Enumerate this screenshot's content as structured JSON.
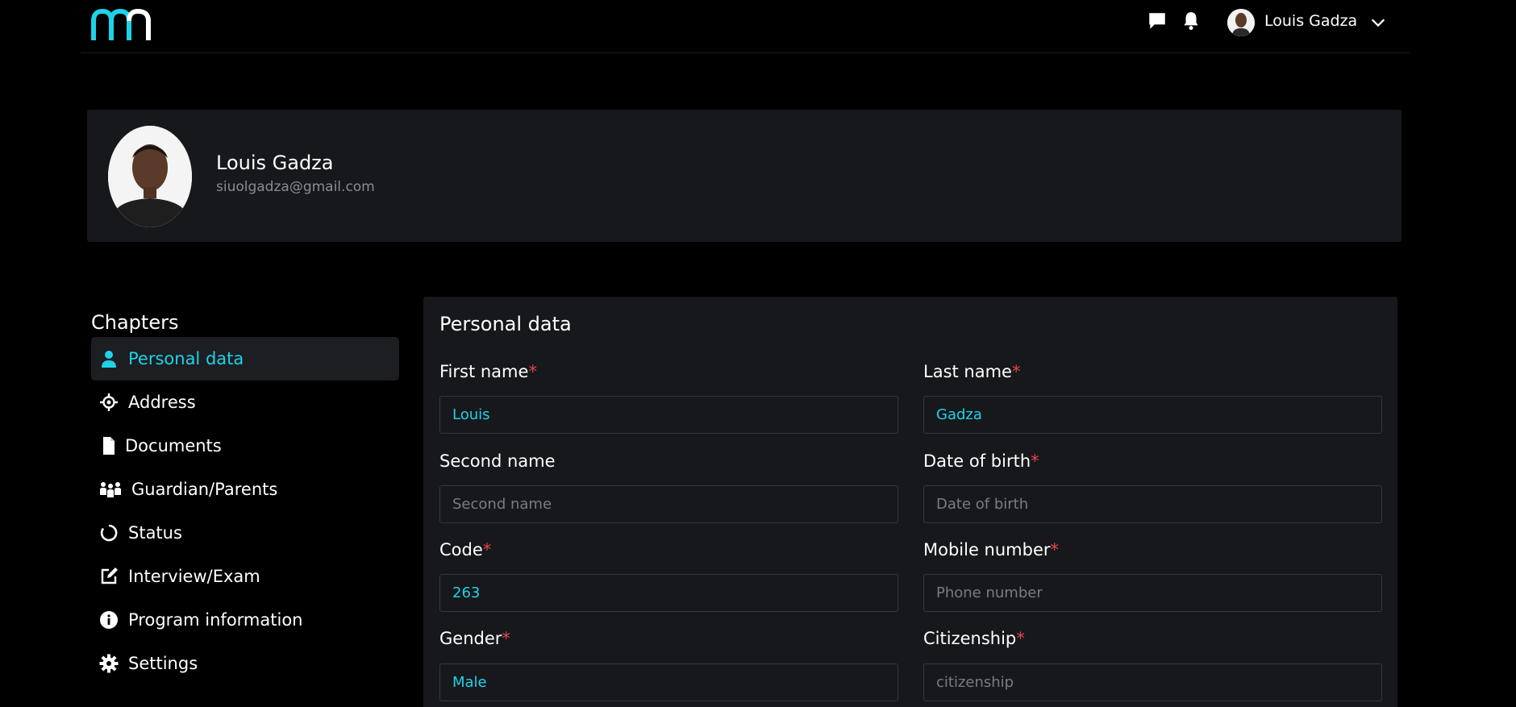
{
  "header": {
    "user_name": "Louis Gadza",
    "icons": [
      "logo-mn",
      "chat-icon",
      "bell-icon",
      "user-avatar",
      "chevron-down-icon"
    ],
    "logo_colors": {
      "m": "#1fd2e8",
      "n": "#ffffff"
    }
  },
  "profile": {
    "name": "Louis Gadza",
    "email": "siuolgadza@gmail.com"
  },
  "sidebar": {
    "title": "Chapters",
    "items": [
      {
        "label": "Personal data",
        "icon": "person-icon",
        "active": true
      },
      {
        "label": "Address",
        "icon": "location-icon"
      },
      {
        "label": "Documents",
        "icon": "document-icon"
      },
      {
        "label": "Guardian/Parents",
        "icon": "family-icon"
      },
      {
        "label": "Status",
        "icon": "status-circle-icon"
      },
      {
        "label": "Interview/Exam",
        "icon": "edit-icon"
      },
      {
        "label": "Program information",
        "icon": "info-icon"
      },
      {
        "label": "Settings",
        "icon": "gear-icon"
      }
    ]
  },
  "form": {
    "title": "Personal data",
    "fields": {
      "first_name": {
        "label": "First name",
        "required": "*",
        "value": "Louis",
        "placeholder": ""
      },
      "last_name": {
        "label": "Last name",
        "required": "*",
        "value": "Gadza",
        "placeholder": ""
      },
      "second_name": {
        "label": "Second name",
        "required": "",
        "value": "",
        "placeholder": "Second name"
      },
      "date_of_birth": {
        "label": "Date of birth",
        "required": "*",
        "value": "",
        "placeholder": "Date of birth"
      },
      "code": {
        "label": "Code",
        "required": "*",
        "value": "263",
        "placeholder": ""
      },
      "mobile_number": {
        "label": "Mobile number",
        "required": "*",
        "value": "",
        "placeholder": "Phone number"
      },
      "gender": {
        "label": "Gender",
        "required": "*",
        "value": "Male",
        "placeholder": ""
      },
      "citizenship": {
        "label": "Citizenship",
        "required": "*",
        "value": "",
        "placeholder": "citizenship"
      }
    }
  },
  "colors": {
    "accent": "#1fd2e8",
    "background": "#000000",
    "panel": "#16181c",
    "required": "#e84545",
    "muted": "#8a8c92"
  }
}
